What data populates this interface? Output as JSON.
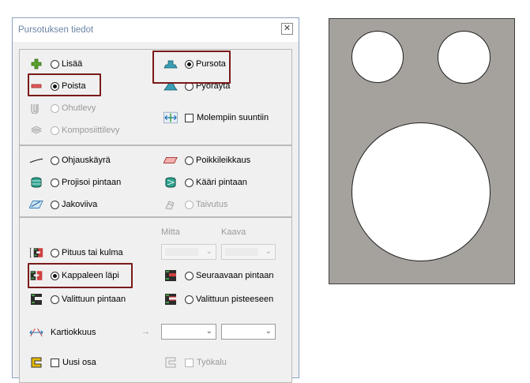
{
  "dialog": {
    "title": "Pursotuksen tiedot",
    "close_glyph": "✕"
  },
  "section1": {
    "add_label": "Lisää",
    "remove_label": "Poista",
    "thinsheet_label": "Ohutlevy",
    "composite_label": "Komposiittilevy",
    "extrude_label": "Pursota",
    "revolve_label": "Pyöräytä",
    "both_directions_label": "Molempiin suuntiin"
  },
  "section2": {
    "guide_curve_label": "Ohjauskäyrä",
    "project_surface_label": "Projisoi pintaan",
    "split_line_label": "Jakoviiva",
    "cross_section_label": "Poikkileikkaus",
    "wrap_surface_label": "Kääri pintaan",
    "bend_label": "Taivutus"
  },
  "section3": {
    "measure_header": "Mitta",
    "formula_header": "Kaava",
    "length_angle_label": "Pituus tai kulma",
    "through_body_label": "Kappaleen läpi",
    "to_next_surface_label": "Seuraavaan pintaan",
    "to_selected_surface_label": "Valittuun pintaan",
    "to_selected_point_label": "Valittuun pisteeseen",
    "taper_label": "Kartiokkuus",
    "arrow_glyph": "→",
    "new_part_label": "Uusi osa",
    "tool_label": "Työkalu"
  },
  "selected": {
    "operation": "Poista",
    "type": "Pursota",
    "extent": "Kappaleen läpi"
  },
  "colors": {
    "highlight_border": "#7a1a1a",
    "preview_fill": "#a5a29d",
    "title_text": "#6b86a8"
  }
}
